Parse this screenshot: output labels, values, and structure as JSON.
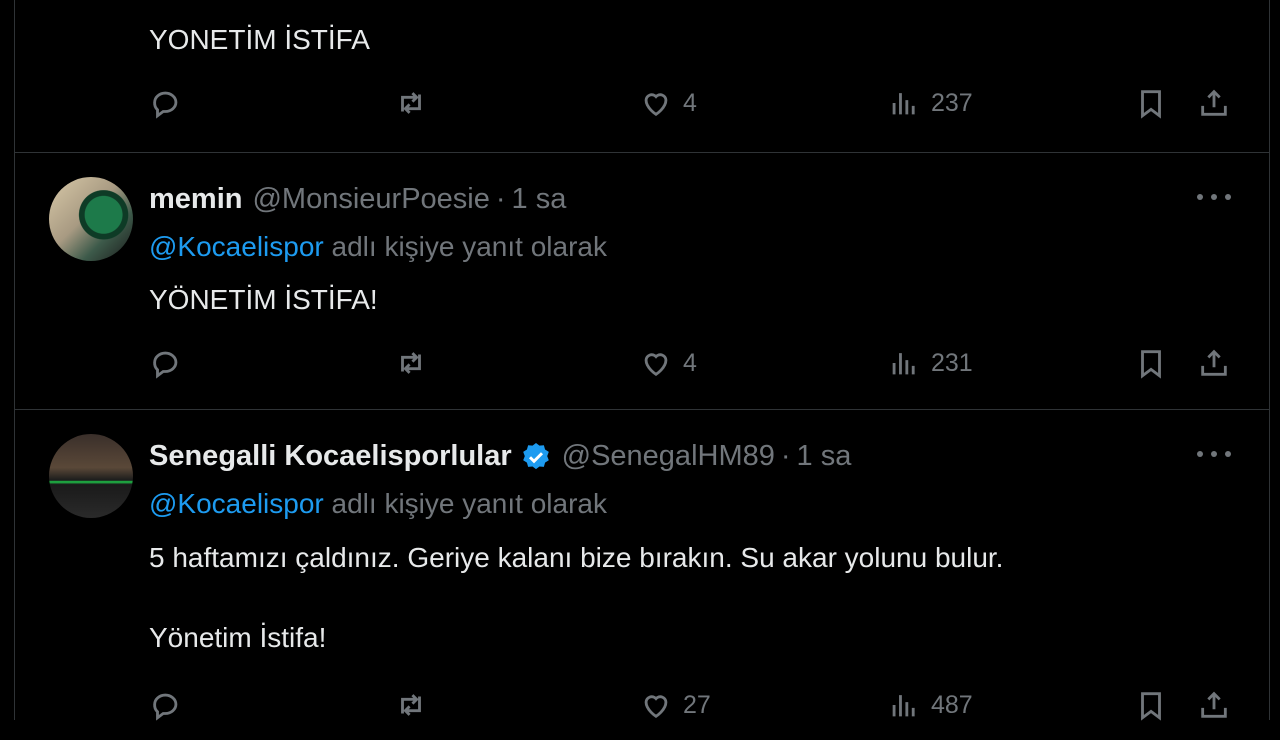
{
  "tweets": [
    {
      "name": "",
      "handle": "",
      "time": "",
      "reply_to": "",
      "reply_suffix": "",
      "text": "YONETİM İSTİFA",
      "likes": "4",
      "views": "237"
    },
    {
      "name": "memin",
      "handle": "@MonsieurPoesie",
      "time": "1 sa",
      "reply_to": "@Kocaelispor",
      "reply_suffix": "adlı kişiye yanıt olarak",
      "text": "YÖNETİM İSTİFA!",
      "likes": "4",
      "views": "231"
    },
    {
      "name": "Senegalli Kocaelisporlular",
      "handle": "@SenegalHM89",
      "time": "1 sa",
      "reply_to": "@Kocaelispor",
      "reply_suffix": "adlı kişiye yanıt olarak",
      "text": "5 haftamızı çaldınız. Geriye kalanı bize bırakın. Su akar yolunu bulur.\n\nYönetim İstifa!",
      "likes": "27",
      "views": "487"
    }
  ],
  "separator": "·",
  "icons": {
    "reply": "reply-icon",
    "retweet": "retweet-icon",
    "like": "heart-icon",
    "views": "analytics-icon",
    "bookmark": "bookmark-icon",
    "share": "share-icon",
    "more": "more-icon",
    "verified": "verified-badge-icon"
  },
  "colors": {
    "background": "#000000",
    "text": "#e7e9ea",
    "muted": "#71767b",
    "link": "#1d9bf0",
    "border": "#2f3336"
  }
}
